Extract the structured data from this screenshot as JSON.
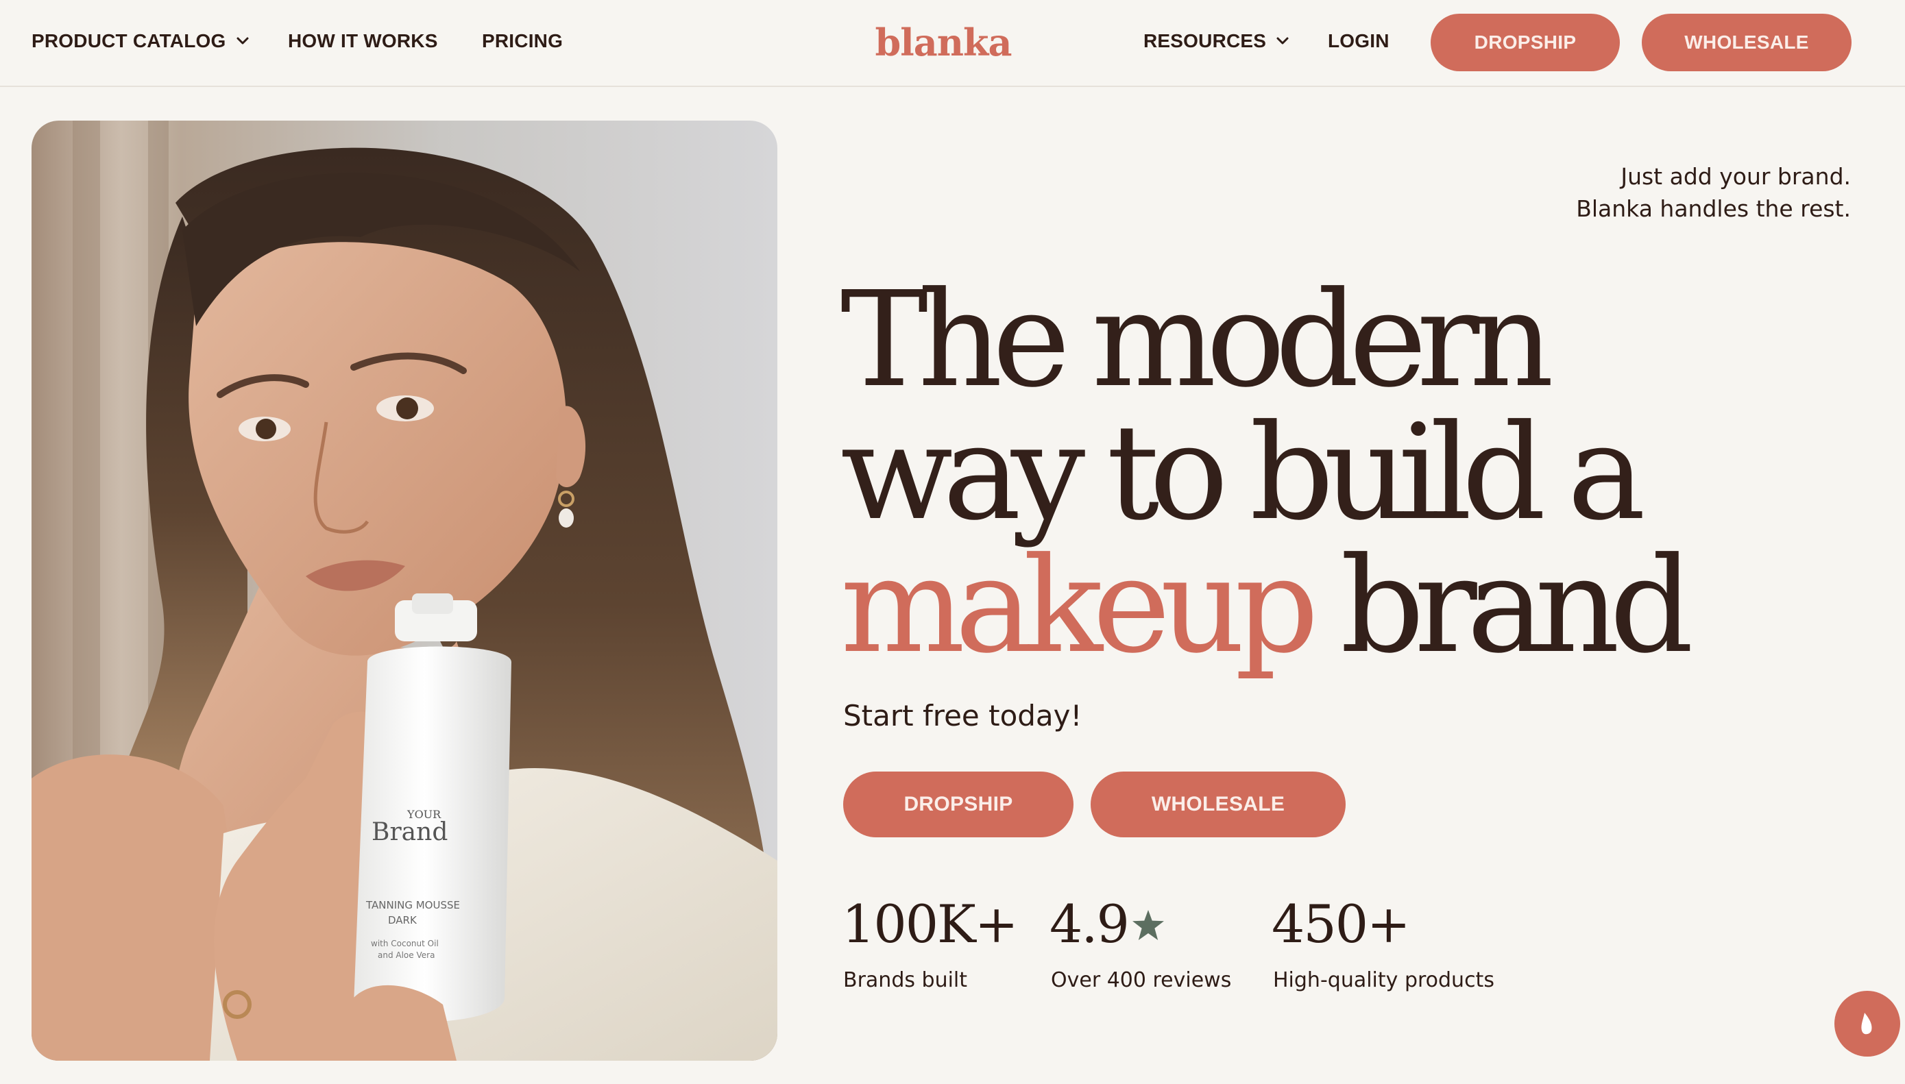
{
  "header": {
    "nav_left": [
      {
        "label": "PRODUCT CATALOG",
        "has_dropdown": true
      },
      {
        "label": "HOW IT WORKS"
      },
      {
        "label": "PRICING"
      }
    ],
    "logo": "blanka",
    "nav_right": [
      {
        "label": "RESOURCES",
        "has_dropdown": true
      },
      {
        "label": "LOGIN"
      }
    ],
    "dropship_label": "DROPSHIP",
    "wholesale_label": "WHOLESALE"
  },
  "hero": {
    "tagline_line1": "Just add your brand.",
    "tagline_line2": "Blanka handles the rest.",
    "headline_line1": "The modern",
    "headline_line2": "way to build a",
    "headline_accent": "makeup",
    "headline_line3_rest": "brand",
    "subheading": "Start free today!",
    "cta_dropship": "DROPSHIP",
    "cta_wholesale": "WHOLESALE",
    "product_label_small": "YOUR",
    "product_label_brand": "Brand",
    "product_label_line1": "TANNING MOUSSE",
    "product_label_line2": "DARK",
    "product_label_line3": "with Coconut Oil",
    "product_label_line4": "and Aloe Vera"
  },
  "stats": [
    {
      "value": "100K+",
      "label": "Brands built"
    },
    {
      "value": "4.9",
      "label": "Over 400 reviews",
      "icon": "star-icon"
    },
    {
      "value": "450+",
      "label": "High-quality products"
    }
  ],
  "colors": {
    "accent": "#d06c5b",
    "text": "#2e1c16",
    "background": "#f7f5f1",
    "star": "#5c6e60"
  }
}
